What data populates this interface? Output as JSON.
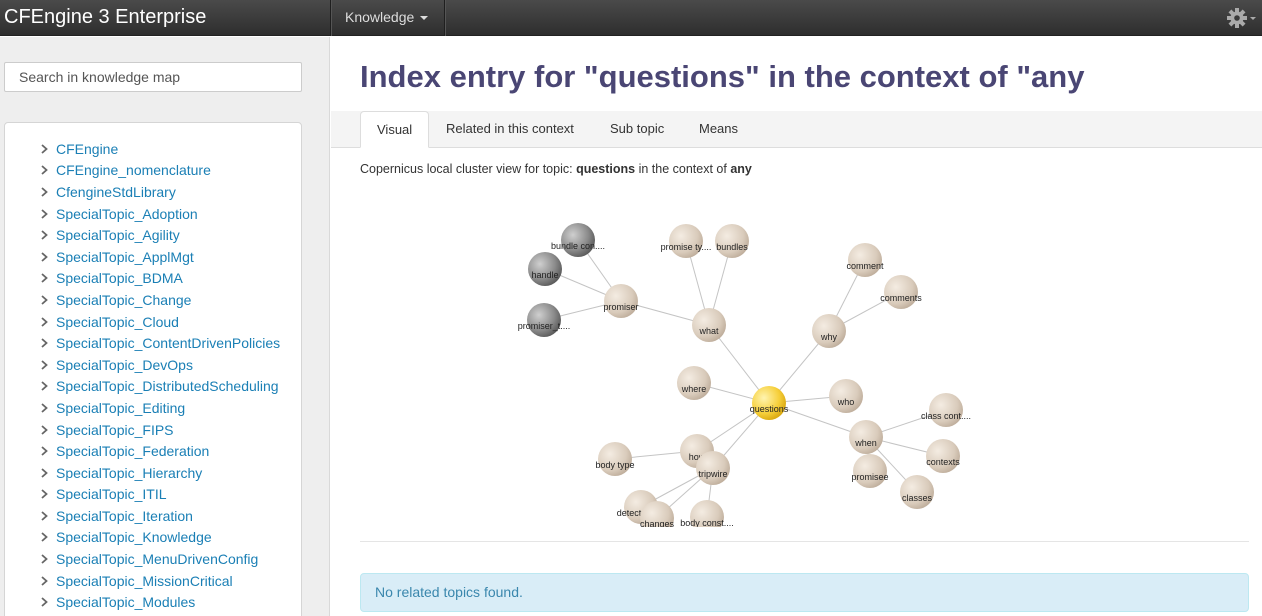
{
  "app": {
    "title": "CFEngine 3 Enterprise"
  },
  "navbar": {
    "knowledge_label": "Knowledge",
    "gear_icon": "gear-icon"
  },
  "sidebar": {
    "search_placeholder": "Search in knowledge map",
    "topics": [
      "CFEngine",
      "CFEngine_nomenclature",
      "CfengineStdLibrary",
      "SpecialTopic_Adoption",
      "SpecialTopic_Agility",
      "SpecialTopic_ApplMgt",
      "SpecialTopic_BDMA",
      "SpecialTopic_Change",
      "SpecialTopic_Cloud",
      "SpecialTopic_ContentDrivenPolicies",
      "SpecialTopic_DevOps",
      "SpecialTopic_DistributedScheduling",
      "SpecialTopic_Editing",
      "SpecialTopic_FIPS",
      "SpecialTopic_Federation",
      "SpecialTopic_Hierarchy",
      "SpecialTopic_ITIL",
      "SpecialTopic_Iteration",
      "SpecialTopic_Knowledge",
      "SpecialTopic_MenuDrivenConfig",
      "SpecialTopic_MissionCritical",
      "SpecialTopic_Modules"
    ]
  },
  "main": {
    "title": "Index entry for \"questions\" in the context of \"any",
    "tabs": [
      {
        "label": "Visual",
        "active": true
      },
      {
        "label": "Related in this context",
        "active": false
      },
      {
        "label": "Sub topic",
        "active": false
      },
      {
        "label": "Means",
        "active": false
      }
    ],
    "cluster": {
      "prefix": "Copernicus local cluster view for topic: ",
      "topic": "questions",
      "middle": " in the context of ",
      "context": "any"
    },
    "graph": {
      "center": "questions",
      "nodes": {
        "questions": {
          "label": "questions",
          "color": "gold"
        },
        "what": {
          "label": "what",
          "color": "tan"
        },
        "why": {
          "label": "why",
          "color": "tan"
        },
        "where": {
          "label": "where",
          "color": "tan"
        },
        "who": {
          "label": "who",
          "color": "tan"
        },
        "when": {
          "label": "when",
          "color": "tan"
        },
        "how": {
          "label": "how",
          "color": "tan"
        },
        "tripwire": {
          "label": "tripwire",
          "color": "tan"
        },
        "promiser": {
          "label": "promiser",
          "color": "tan"
        },
        "bundle_con": {
          "label": "bundle con....",
          "color": "gray"
        },
        "handle": {
          "label": "handle",
          "color": "gray"
        },
        "promiser_t": {
          "label": "promiser_t....",
          "color": "gray"
        },
        "promise_ty": {
          "label": "promise ty....",
          "color": "tan"
        },
        "bundles": {
          "label": "bundles",
          "color": "tan"
        },
        "comment": {
          "label": "comment",
          "color": "tan"
        },
        "comments": {
          "label": "comments",
          "color": "tan"
        },
        "class_cont": {
          "label": "class cont....",
          "color": "tan"
        },
        "contexts": {
          "label": "contexts",
          "color": "tan"
        },
        "classes": {
          "label": "classes",
          "color": "tan"
        },
        "promisee": {
          "label": "promisee",
          "color": "tan"
        },
        "body_type": {
          "label": "body type",
          "color": "tan"
        },
        "detect_all": {
          "label": "detect_all....",
          "color": "tan"
        },
        "changes": {
          "label": "changes",
          "color": "tan"
        },
        "body_const": {
          "label": "body const....",
          "color": "tan"
        }
      },
      "edges": [
        [
          "questions",
          "what"
        ],
        [
          "questions",
          "why"
        ],
        [
          "questions",
          "where"
        ],
        [
          "questions",
          "who"
        ],
        [
          "questions",
          "when"
        ],
        [
          "questions",
          "how"
        ],
        [
          "questions",
          "tripwire"
        ],
        [
          "what",
          "promiser"
        ],
        [
          "what",
          "promise_ty"
        ],
        [
          "what",
          "bundles"
        ],
        [
          "promiser",
          "bundle_con"
        ],
        [
          "promiser",
          "handle"
        ],
        [
          "promiser",
          "promiser_t"
        ],
        [
          "why",
          "comment"
        ],
        [
          "why",
          "comments"
        ],
        [
          "when",
          "class_cont"
        ],
        [
          "when",
          "contexts"
        ],
        [
          "when",
          "classes"
        ],
        [
          "when",
          "promisee"
        ],
        [
          "how",
          "body_type"
        ],
        [
          "tripwire",
          "detect_all"
        ],
        [
          "tripwire",
          "changes"
        ],
        [
          "tripwire",
          "body_const"
        ]
      ]
    },
    "alert": "No related topics found."
  }
}
